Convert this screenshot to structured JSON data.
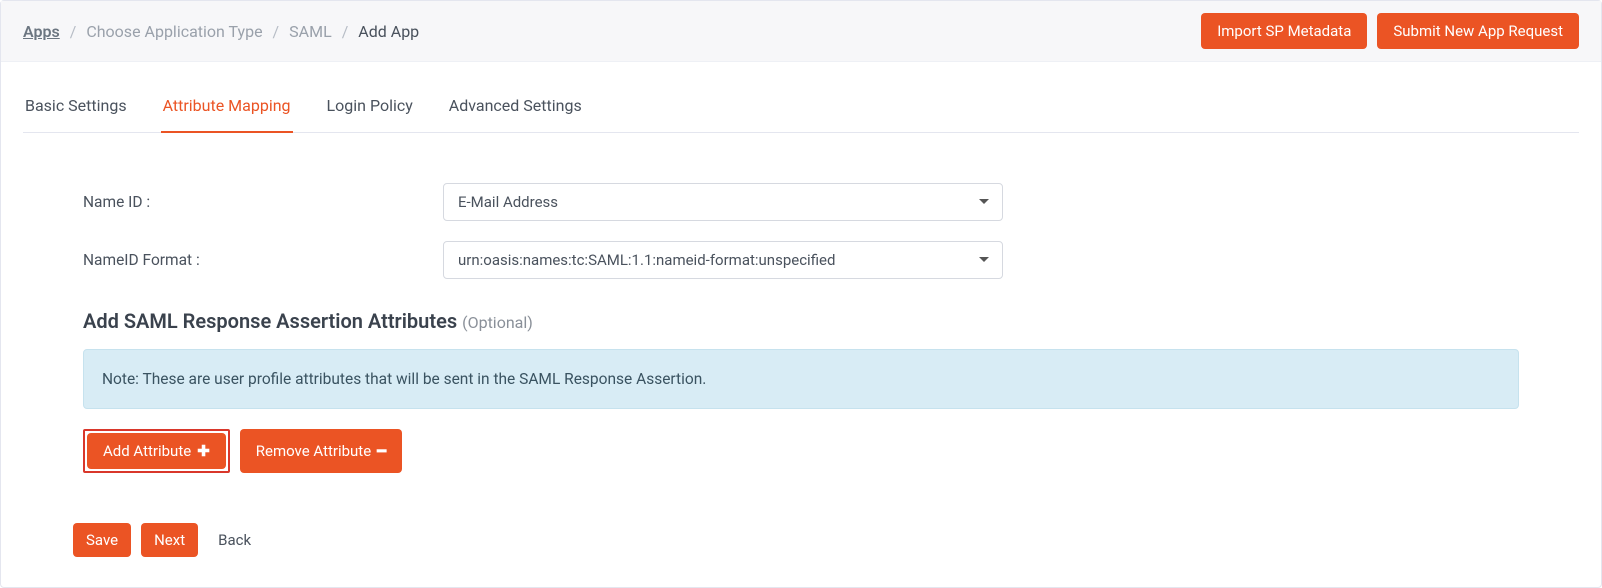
{
  "breadcrumb": {
    "apps": "Apps",
    "choose": "Choose Application Type",
    "saml": "SAML",
    "addapp": "Add App"
  },
  "header": {
    "import_label": "Import SP Metadata",
    "submit_label": "Submit New App Request"
  },
  "tabs": {
    "basic": "Basic Settings",
    "attribute": "Attribute Mapping",
    "login": "Login Policy",
    "advanced": "Advanced Settings"
  },
  "form": {
    "nameid_label": "Name ID :",
    "nameid_value": "E-Mail Address",
    "nameid_format_label": "NameID Format :",
    "nameid_format_value": "urn:oasis:names:tc:SAML:1.1:nameid-format:unspecified"
  },
  "section": {
    "title": "Add SAML Response Assertion Attributes ",
    "optional": "(Optional)",
    "note": "Note: These are user profile attributes that will be sent in the SAML Response Assertion."
  },
  "buttons": {
    "add_attr": "Add Attribute",
    "remove_attr": "Remove Attribute",
    "save": "Save",
    "next": "Next",
    "back": "Back"
  }
}
